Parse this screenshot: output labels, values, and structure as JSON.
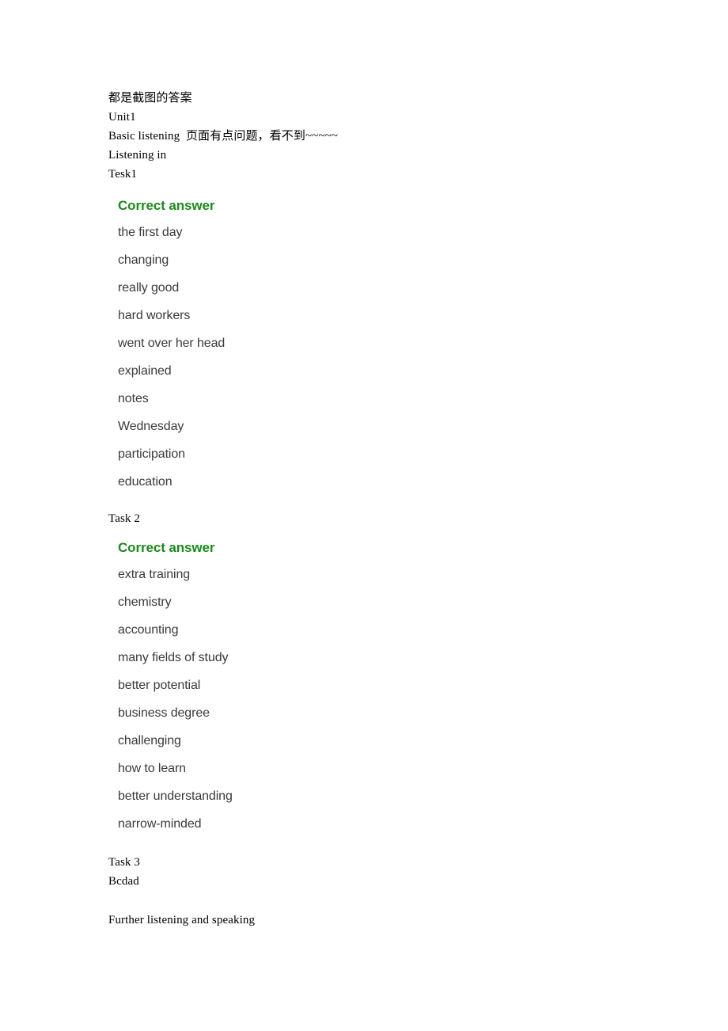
{
  "document": {
    "header_lines": [
      {
        "text": "都是截图的答案",
        "script": "cjk"
      },
      {
        "text": "Unit1",
        "script": "latin"
      },
      {
        "text": "Basic listening  页面有点问题，看不到~~~~~",
        "script": "mixed"
      },
      {
        "text": "Listening in",
        "script": "latin"
      },
      {
        "text": "Tesk1",
        "script": "latin"
      }
    ],
    "task2_label": "Task 2",
    "task3_label": "Task 3",
    "task3_answer": "Bcdad",
    "further_section_label": "Further listening and speaking"
  },
  "answer_cards": [
    {
      "title": "Correct answer",
      "title_color": "#1d8a1d",
      "items": [
        "the first day",
        "changing",
        "really good",
        "hard workers",
        "went over her head",
        "explained",
        "notes",
        "Wednesday",
        "participation",
        "education"
      ]
    },
    {
      "title": "Correct answer",
      "title_color": "#1d8a1d",
      "items": [
        "extra training",
        "chemistry",
        "accounting",
        "many fields of study",
        "better potential",
        "business degree",
        "challenging",
        "how to learn",
        "better understanding",
        "narrow-minded"
      ]
    }
  ],
  "colors": {
    "page_background": "#ffffff",
    "body_text": "#000000",
    "answer_item_text": "#3a3a3a",
    "correct_answer_green": "#1d8a1d"
  }
}
